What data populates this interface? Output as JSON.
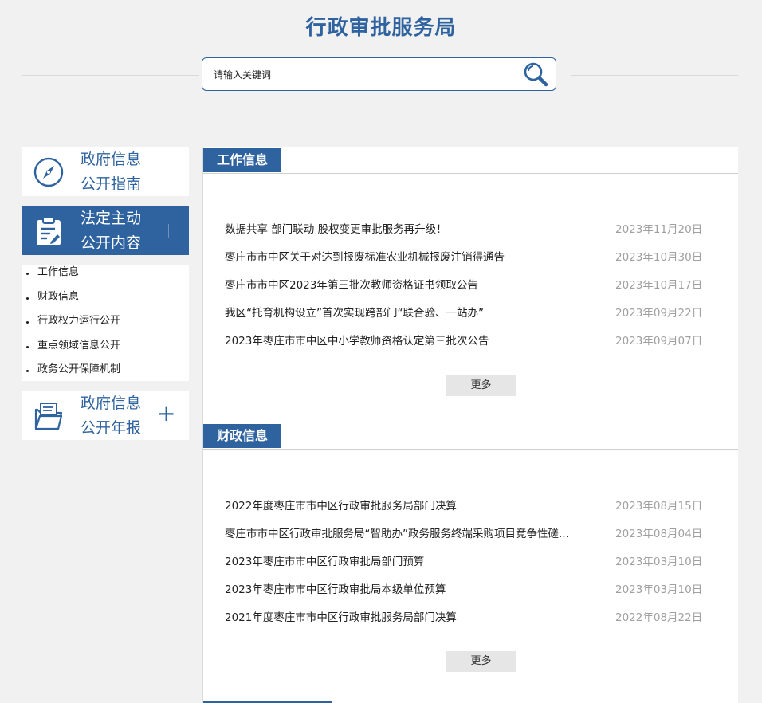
{
  "header": {
    "title": "行政审批服务局"
  },
  "search": {
    "placeholder": "请输入关键词",
    "icon": "search-icon"
  },
  "sidebar": {
    "cards": [
      {
        "line1": "政府信息",
        "line2": "公开指南",
        "icon": "compass-icon"
      },
      {
        "line1": "法定主动",
        "line2": "公开内容",
        "icon": "clipboard-icon"
      },
      {
        "line1": "政府信息",
        "line2": "公开年报",
        "icon": "folder-icon"
      }
    ],
    "sub_items": [
      "工作信息",
      "财政信息",
      "行政权力运行公开",
      "重点领域信息公开",
      "政务公开保障机制"
    ],
    "expand_symbol": "+"
  },
  "sections": [
    {
      "tab": "工作信息",
      "more_label": "更多",
      "items": [
        {
          "title": "数据共享 部门联动 股权变更审批服务再升级！",
          "date": "2023年11月20日"
        },
        {
          "title": "枣庄市市中区关于对达到报废标准农业机械报废注销得通告",
          "date": "2023年10月30日"
        },
        {
          "title": "枣庄市市中区2023年第三批次教师资格证书领取公告",
          "date": "2023年10月17日"
        },
        {
          "title": "我区“托育机构设立”首次实现跨部门“联合验、一站办”",
          "date": "2023年09月22日"
        },
        {
          "title": "2023年枣庄市市中区中小学教师资格认定第三批次公告",
          "date": "2023年09月07日"
        }
      ]
    },
    {
      "tab": "财政信息",
      "more_label": "更多",
      "items": [
        {
          "title": "2022年度枣庄市市中区行政审批服务局部门决算",
          "date": "2023年08月15日"
        },
        {
          "title": "枣庄市市中区行政审批服务局“智助办”政务服务终端采购项目竞争性磋...",
          "date": "2023年08月04日"
        },
        {
          "title": "2023年枣庄市市中区行政审批局部门预算",
          "date": "2023年03月10日"
        },
        {
          "title": "2023年枣庄市市中区行政审批局本级单位预算",
          "date": "2023年03月10日"
        },
        {
          "title": "2021年度枣庄市市中区行政审批服务局部门决算",
          "date": "2022年08月22日"
        }
      ]
    }
  ],
  "colors": {
    "brand": "#2f63a0",
    "background": "#f1f1f1",
    "date_text": "#a0a0a0",
    "more_button_bg": "#e6e6e6"
  }
}
